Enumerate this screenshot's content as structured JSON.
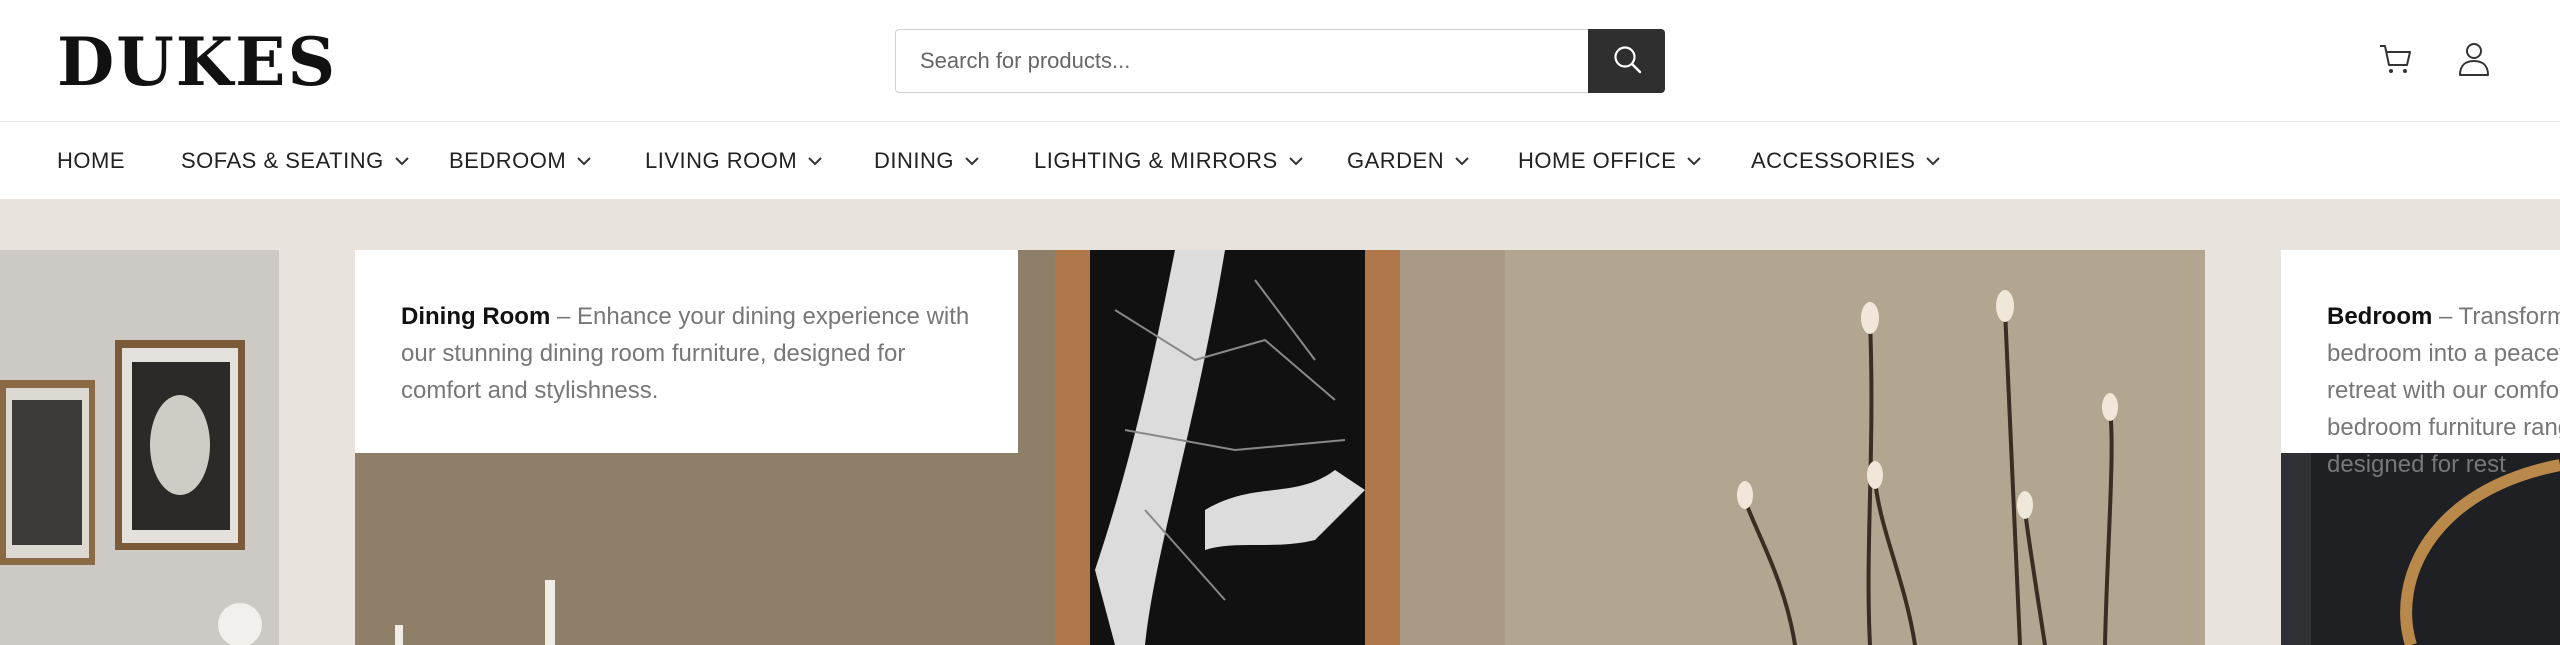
{
  "header": {
    "logo": "DUKES",
    "search_placeholder": "Search for products...",
    "search_icon": "search-icon",
    "cart_icon": "cart-icon",
    "account_icon": "user-icon"
  },
  "nav": {
    "items": [
      {
        "label": "HOME",
        "has_dropdown": false
      },
      {
        "label": "SOFAS & SEATING",
        "has_dropdown": true
      },
      {
        "label": "BEDROOM",
        "has_dropdown": true
      },
      {
        "label": "LIVING ROOM",
        "has_dropdown": true
      },
      {
        "label": "DINING",
        "has_dropdown": true
      },
      {
        "label": "LIGHTING & MIRRORS",
        "has_dropdown": true
      },
      {
        "label": "GARDEN",
        "has_dropdown": true
      },
      {
        "label": "HOME OFFICE",
        "has_dropdown": true
      },
      {
        "label": "ACCESSORIES",
        "has_dropdown": true
      }
    ]
  },
  "hero": {
    "slides": [
      {
        "title": "Dining Room",
        "text": " – Enhance your dining experience with our stunning dining room furniture, designed for comfort and stylishness."
      },
      {
        "title": "Bedroom",
        "text": " – Transform your bedroom into a peaceful retreat with our comfortable bedroom furniture range, designed for rest"
      }
    ]
  },
  "colors": {
    "hero_background": "#e8e3dc",
    "search_button": "#2f2f2f"
  }
}
